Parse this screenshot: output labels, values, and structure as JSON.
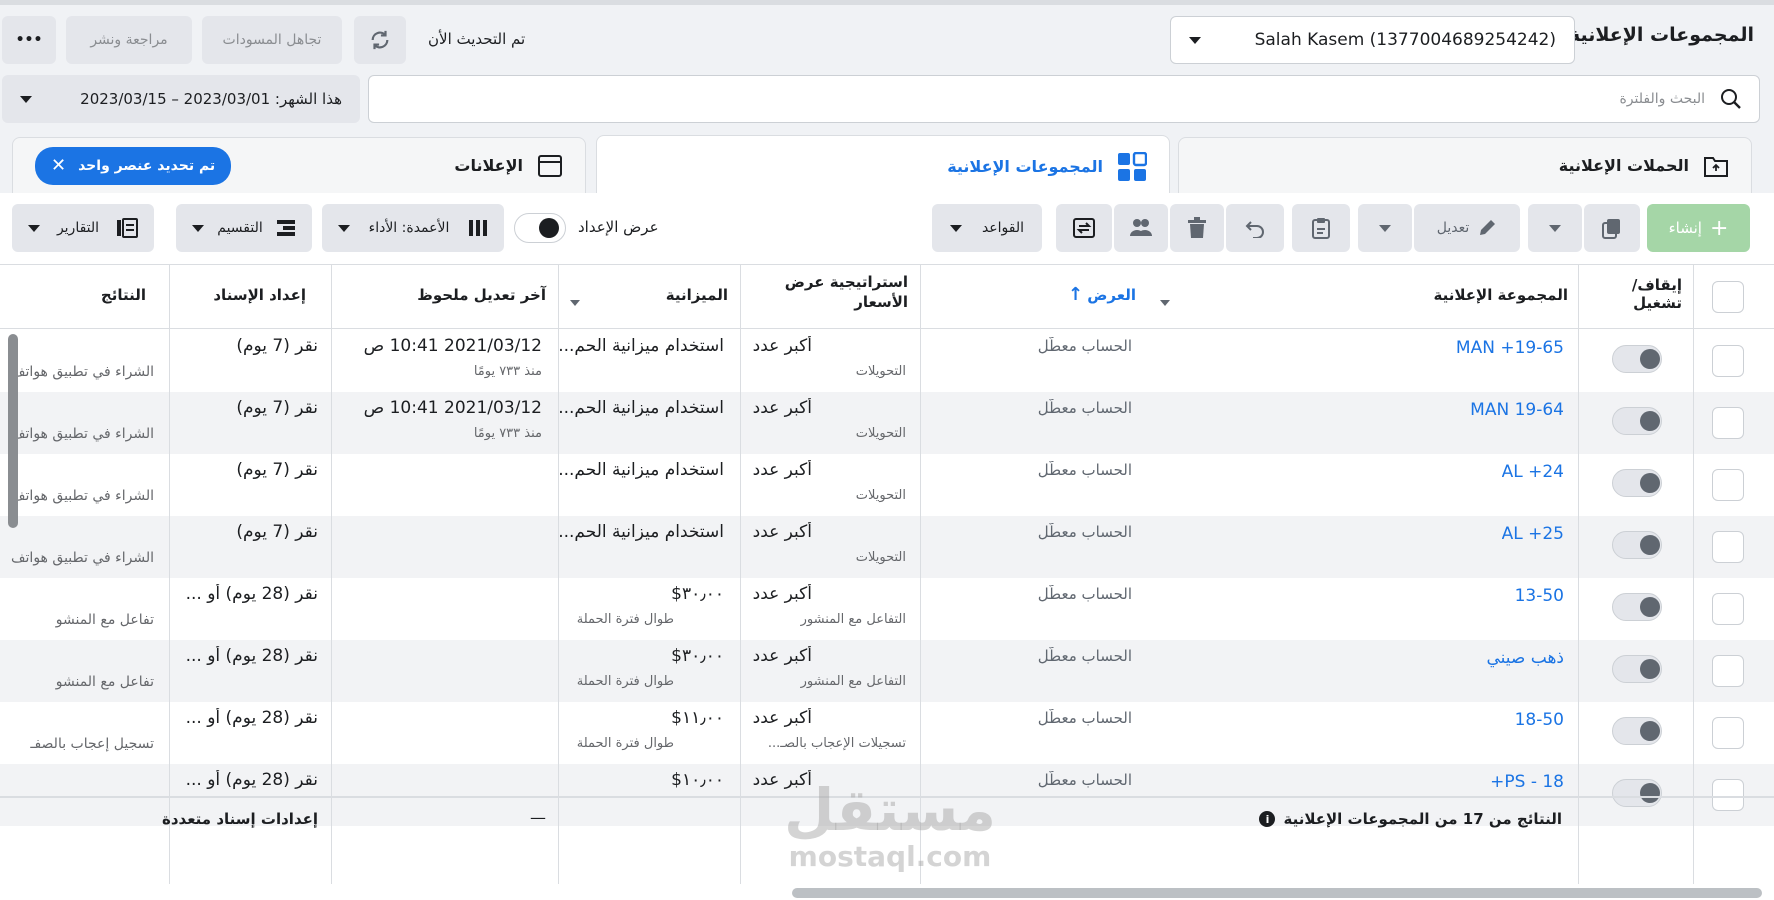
{
  "header": {
    "title": "المجموعات الإعلانية",
    "account": "Salah Kasem (1377004689254242)",
    "updated_text": "تم التحديث الأن",
    "discard_label": "تجاهل المسودات",
    "review_label": "مراجعة ونشر",
    "more_label": "•••"
  },
  "search": {
    "placeholder": "البحث والفلترة",
    "date_range": "هذا الشهر: 2023/03/01 – 2023/03/15"
  },
  "tabs": {
    "campaigns": "الحملات الإعلانية",
    "adsets": "المجموعات الإعلانية",
    "ads": "الإعلانات",
    "selection_badge": "تم تحديد عنصر واحد"
  },
  "toolbar": {
    "create": "إنشاء",
    "edit": "تعديل",
    "rules": "القواعد",
    "view_setup": "عرض الإعداد",
    "columns": "الأعمدة: الأداء",
    "breakdown": "التقسيم",
    "reports": "التقارير"
  },
  "columns": {
    "toggle": "إيقاف/ تشغيل",
    "adset": "المجموعة الإعلانية",
    "delivery": "العرض",
    "bid_strategy": "استراتيجية عرض الأسعار",
    "budget": "الميزانية",
    "last_edit": "آخر تعديل ملحوظ",
    "attribution": "إعداد الإسناد",
    "results": "النتائج"
  },
  "rows": [
    {
      "name": "19-65+ MAN",
      "delivery": "الحساب معطّل",
      "bid": "أكبر عدد",
      "bid_sub": "التحويلات",
      "budget": "استخدام ميزانية الحم...",
      "budget_sub": "",
      "edit": "2021/03/12 10:41 ص",
      "edit_sub": "منذ ٧٣٣ يومًا",
      "attr": "نقر (7 يوم)",
      "result": "الشراء في تطبيق هواتف"
    },
    {
      "name": "19-64 MAN",
      "delivery": "الحساب معطّل",
      "bid": "أكبر عدد",
      "bid_sub": "التحويلات",
      "budget": "استخدام ميزانية الحم...",
      "budget_sub": "",
      "edit": "2021/03/12 10:41 ص",
      "edit_sub": "منذ ٧٣٣ يومًا",
      "attr": "نقر (7 يوم)",
      "result": "الشراء في تطبيق هواتف"
    },
    {
      "name": "24+ AL",
      "delivery": "الحساب معطّل",
      "bid": "أكبر عدد",
      "bid_sub": "التحويلات",
      "budget": "استخدام ميزانية الحم...",
      "budget_sub": "",
      "edit": "",
      "edit_sub": "",
      "attr": "نقر (7 يوم)",
      "result": "الشراء في تطبيق هواتف"
    },
    {
      "name": "25+ AL",
      "delivery": "الحساب معطّل",
      "bid": "أكبر عدد",
      "bid_sub": "التحويلات",
      "budget": "استخدام ميزانية الحم...",
      "budget_sub": "",
      "edit": "",
      "edit_sub": "",
      "attr": "نقر (7 يوم)",
      "result": "الشراء في تطبيق هواتف"
    },
    {
      "name": "13-50",
      "delivery": "الحساب معطّل",
      "bid": "أكبر عدد",
      "bid_sub": "التفاعل مع المنشور",
      "budget": "٣٠٫٠٠$",
      "budget_sub": "طوال فترة الحملة",
      "edit": "",
      "edit_sub": "",
      "attr": "نقر (28 يوم) أو ...",
      "result": "تفاعل مع المنشو"
    },
    {
      "name": "ذهب صيني",
      "delivery": "الحساب معطّل",
      "bid": "أكبر عدد",
      "bid_sub": "التفاعل مع المنشور",
      "budget": "٣٠٫٠٠$",
      "budget_sub": "طوال فترة الحملة",
      "edit": "",
      "edit_sub": "",
      "attr": "نقر (28 يوم) أو ...",
      "result": "تفاعل مع المنشو"
    },
    {
      "name": "18-50",
      "delivery": "الحساب معطّل",
      "bid": "أكبر عدد",
      "bid_sub": "تسجيلات الإعجاب بالصـ...",
      "budget": "١١٫٠٠$",
      "budget_sub": "طوال فترة الحملة",
      "edit": "",
      "edit_sub": "",
      "attr": "نقر (28 يوم) أو ...",
      "result": "تسجيل إعجاب بالصفـ"
    },
    {
      "name": "PS - 18+",
      "delivery": "الحساب معطّل",
      "bid": "أكبر عدد",
      "bid_sub": "",
      "budget": "١٠٫٠٠$",
      "budget_sub": "",
      "edit": "",
      "edit_sub": "",
      "attr": "نقر (28 يوم) أو ...",
      "result": ""
    }
  ],
  "footer": {
    "summary": "النتائج من 17 من المجموعات الإعلانية",
    "budget_dash": "—",
    "attribution": "إعدادات إسناد متعددة"
  },
  "watermark": {
    "arabic": "مستقل",
    "latin": "mostaql.com"
  }
}
